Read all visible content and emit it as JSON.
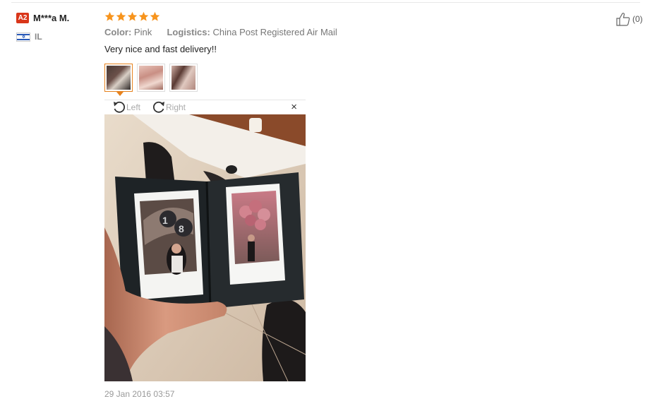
{
  "user": {
    "level_badge": "A2",
    "name": "M***a M.",
    "country_code": "IL"
  },
  "review": {
    "rating": 5,
    "color_label": "Color:",
    "color_value": "Pink",
    "logistics_label": "Logistics:",
    "logistics_value": "China Post Registered Air Mail",
    "text": "Very nice and fast delivery!!",
    "date": "29 Jan 2016 03:57",
    "likes": "(0)"
  },
  "viewer": {
    "rotate_left_label": "Left",
    "rotate_right_label": "Right",
    "close_label": "×"
  },
  "colors": {
    "badge": "#d9361a",
    "star": "#f7941d",
    "active_thumb": "#e6821e"
  },
  "icons": [
    "thumbs-up-icon",
    "rotate-left-icon",
    "rotate-right-icon",
    "close-icon",
    "star-icon",
    "israel-flag-icon"
  ]
}
